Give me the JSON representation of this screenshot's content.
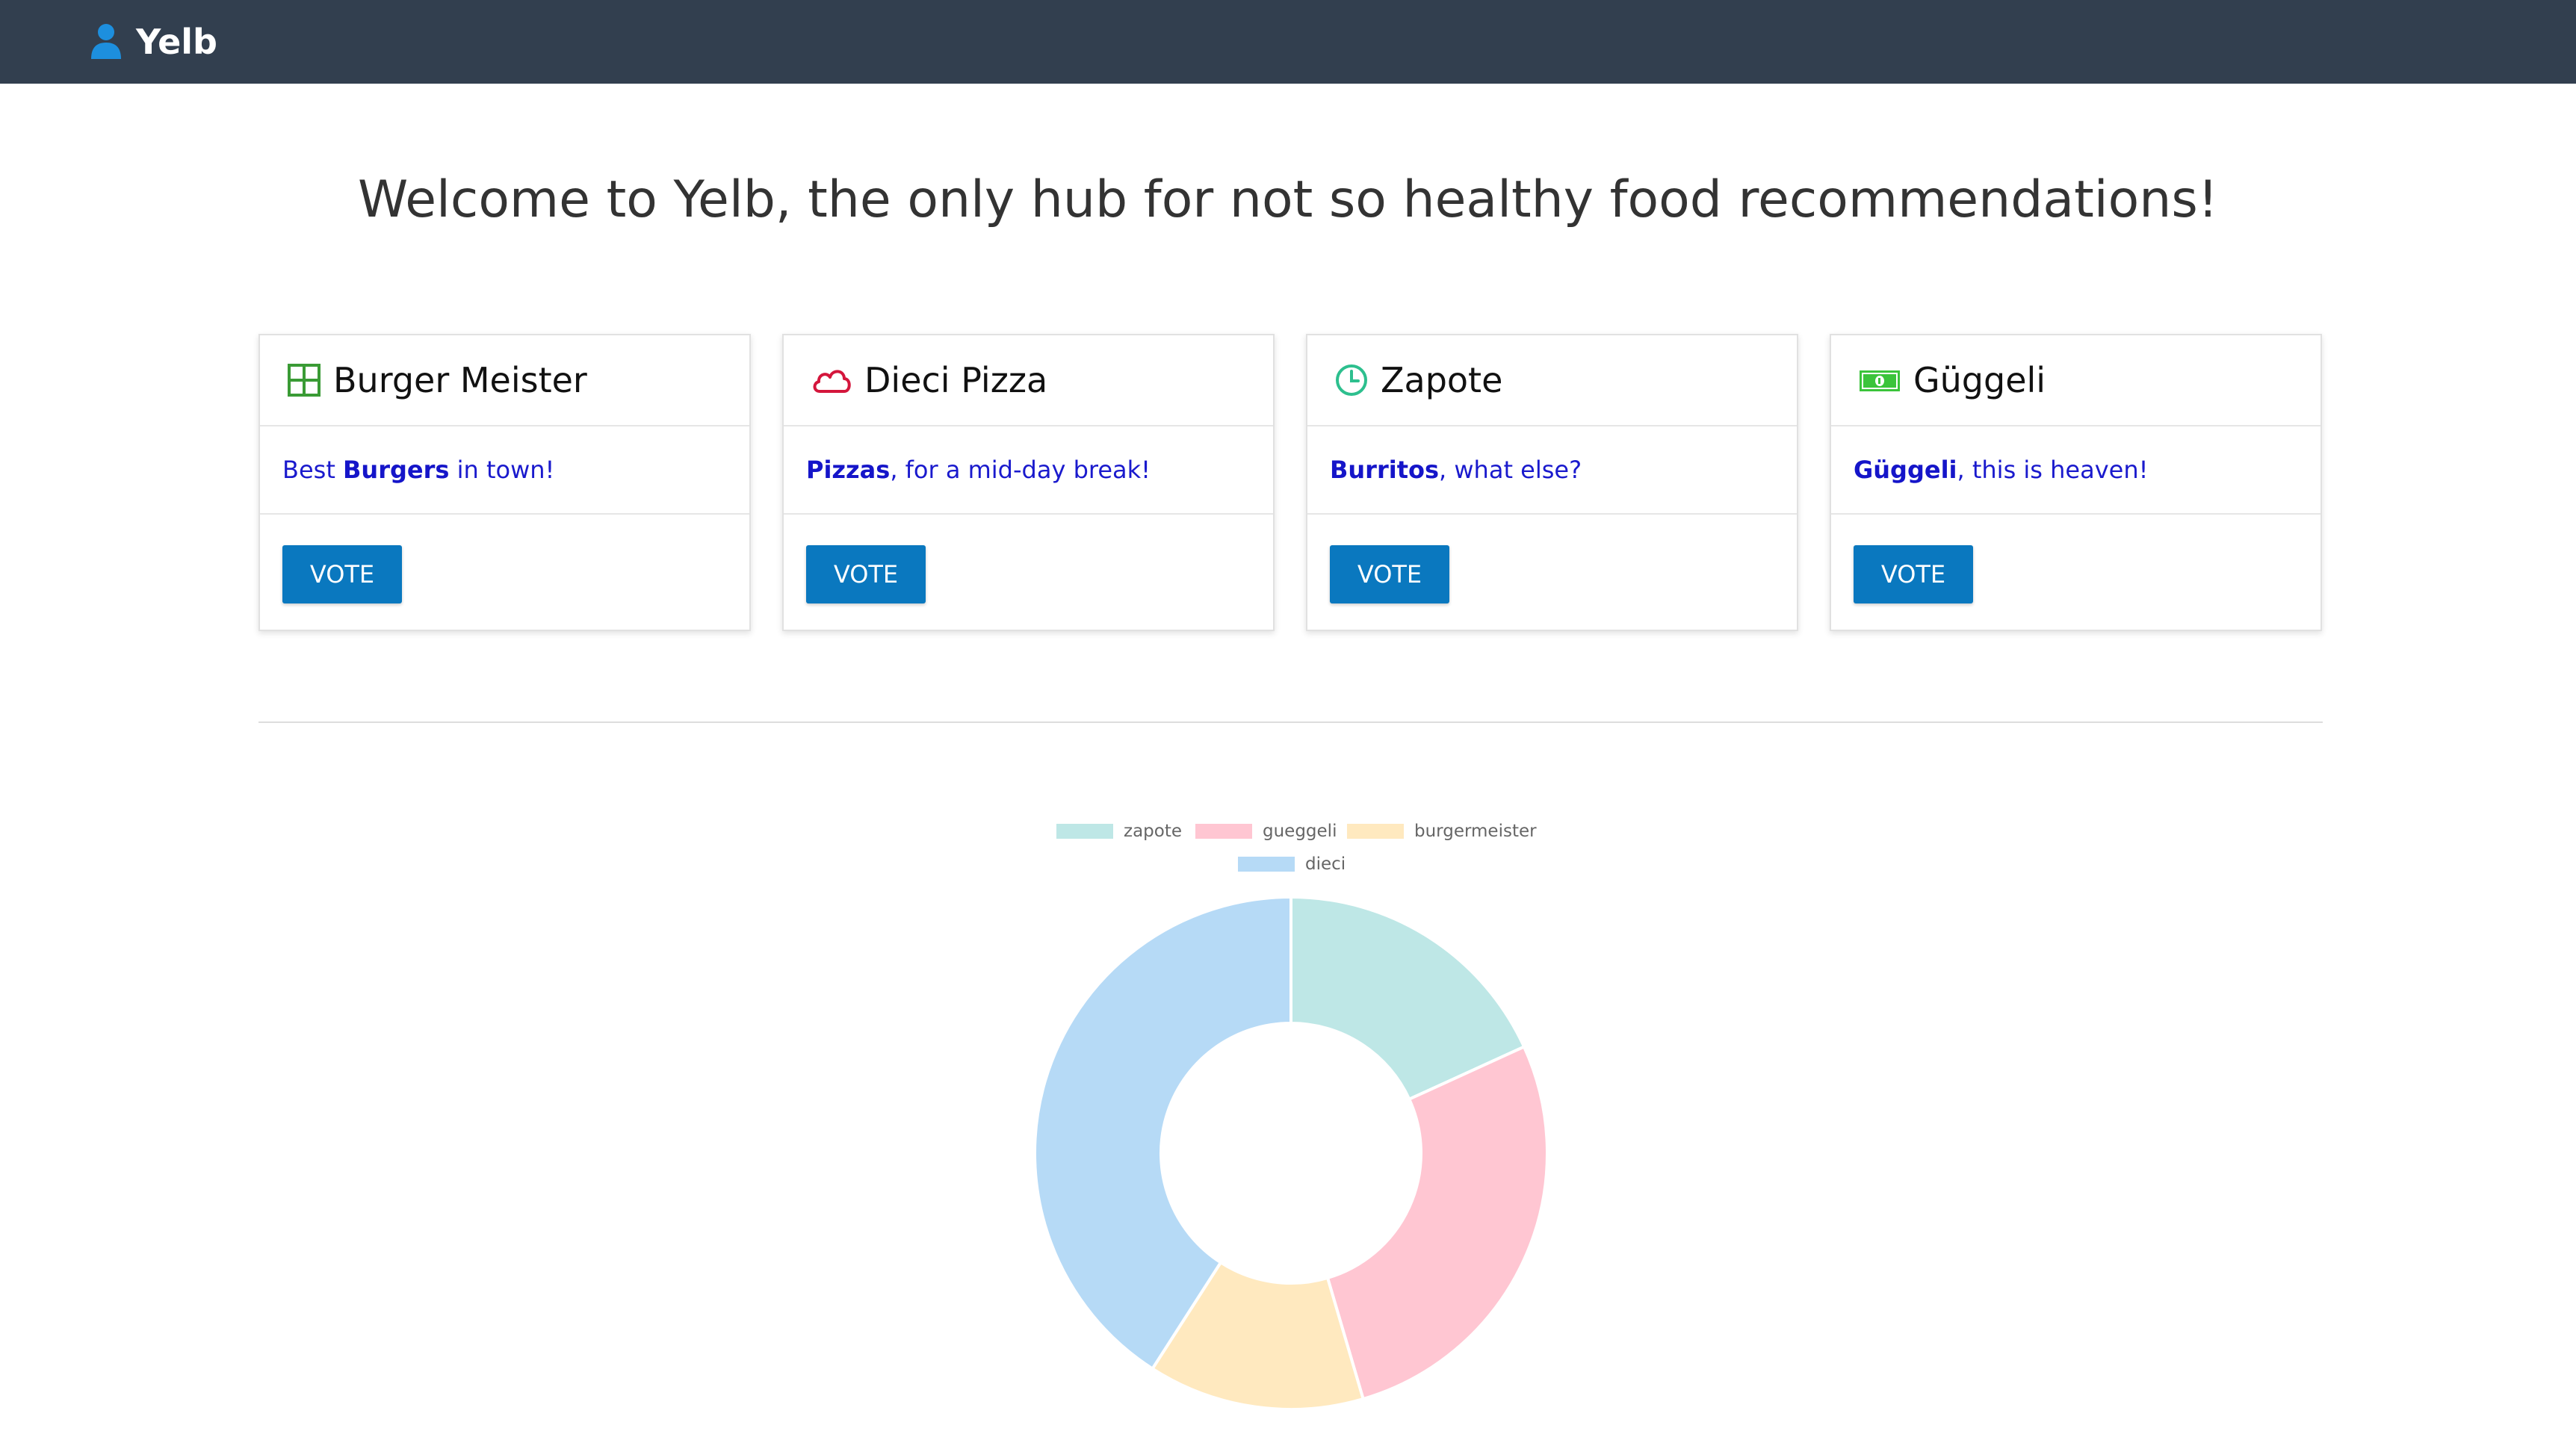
{
  "app": {
    "name": "Yelb",
    "welcome": "Welcome to Yelb, the only hub for not so healthy food recommendations!"
  },
  "restaurants": [
    {
      "title": "Burger Meister",
      "icon": "grid-icon",
      "icon_color": "#3a9b35",
      "desc_pre": "Best ",
      "desc_bold": "Burgers",
      "desc_post": " in town!",
      "vote_label": "VOTE"
    },
    {
      "title": "Dieci Pizza",
      "icon": "cloud-icon",
      "icon_color": "#d4163c",
      "desc_pre": "",
      "desc_bold": "Pizzas",
      "desc_post": ", for a mid-day break!",
      "vote_label": "VOTE"
    },
    {
      "title": "Zapote",
      "icon": "clock-icon",
      "icon_color": "#2dbf8e",
      "desc_pre": "",
      "desc_bold": "Burritos",
      "desc_post": ", what else?",
      "vote_label": "VOTE"
    },
    {
      "title": "Güggeli",
      "icon": "money-icon",
      "icon_color": "#3bc43b",
      "desc_pre": "",
      "desc_bold": "Güggeli",
      "desc_post": ", this is heaven!",
      "vote_label": "VOTE"
    }
  ],
  "colors": {
    "topbar": "#323f4f",
    "accent": "#0a78bf",
    "link": "#1a1acd"
  },
  "chart_data": {
    "type": "pie",
    "variant": "doughnut",
    "legend_position": "top",
    "labels": [
      "zapote",
      "gueggeli",
      "burgermeister",
      "dieci"
    ],
    "values": [
      2,
      3,
      1.5,
      4.5
    ],
    "colors": [
      "#bee7e6",
      "#ffc6d2",
      "#ffe9bf",
      "#b6daf6"
    ]
  }
}
